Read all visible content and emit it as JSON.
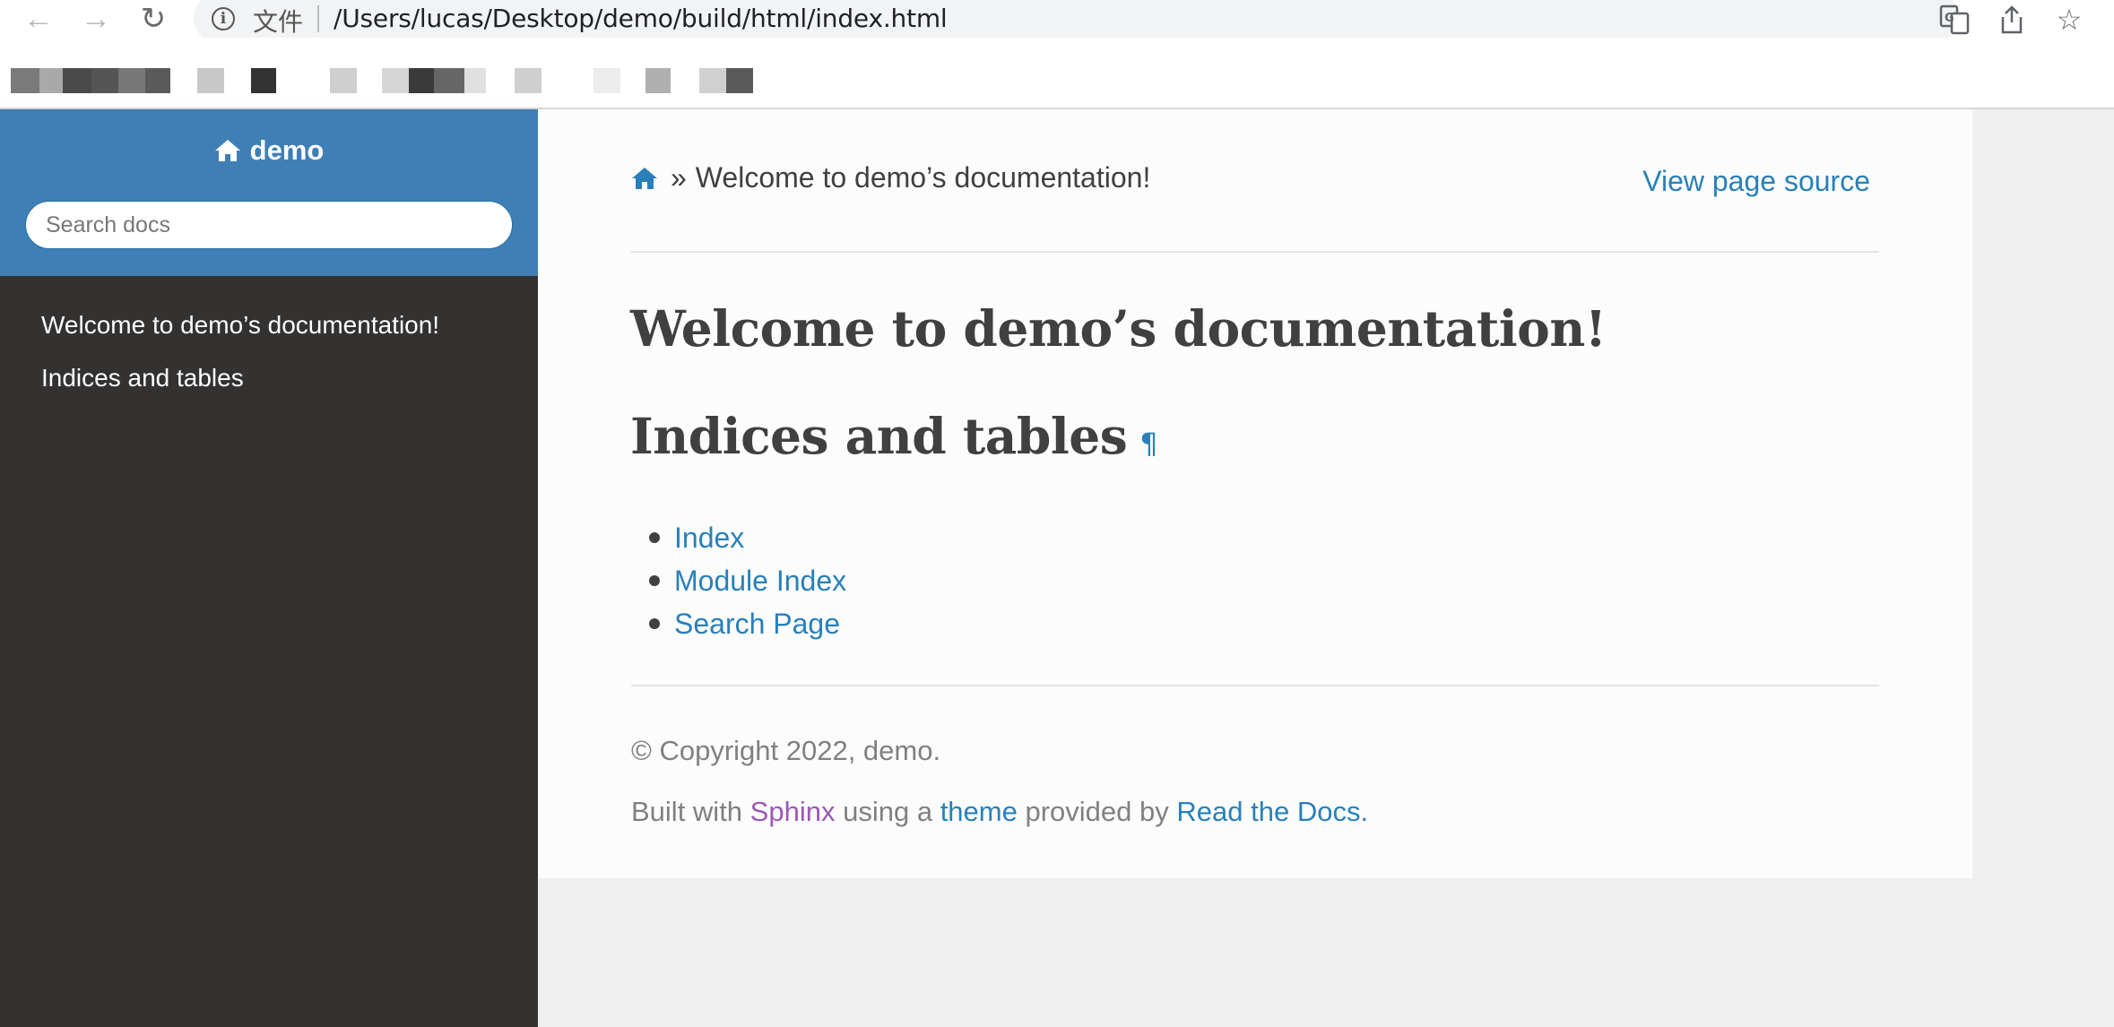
{
  "browser": {
    "scheme_label": "文件",
    "url": "/Users/lucas/Desktop/demo/build/html/index.html"
  },
  "sidebar": {
    "project_name": "demo",
    "search_placeholder": "Search docs",
    "items": [
      {
        "label": "Welcome to demo’s documentation!"
      },
      {
        "label": "Indices and tables"
      }
    ]
  },
  "breadcrumb": {
    "separator": "»",
    "current": "Welcome to demo’s documentation!"
  },
  "view_source_label": "View page source",
  "main": {
    "h1": "Welcome to demo’s documentation!",
    "h2": "Indices and tables",
    "pilcrow": "¶",
    "links": [
      {
        "label": "Index"
      },
      {
        "label": "Module Index"
      },
      {
        "label": "Search Page"
      }
    ]
  },
  "footer": {
    "copyright": "© Copyright 2022, demo.",
    "built_prefix": "Built with",
    "sphinx": "Sphinx",
    "using_a": "using a",
    "theme": "theme",
    "provided_by": "provided by",
    "rtd": "Read the Docs",
    "period": "."
  },
  "colors": {
    "accent": "#2980b9",
    "sidebar_bg": "#343131",
    "sidebar_header_bg": "#3f7fb6",
    "visited_link": "#9b59b6"
  }
}
